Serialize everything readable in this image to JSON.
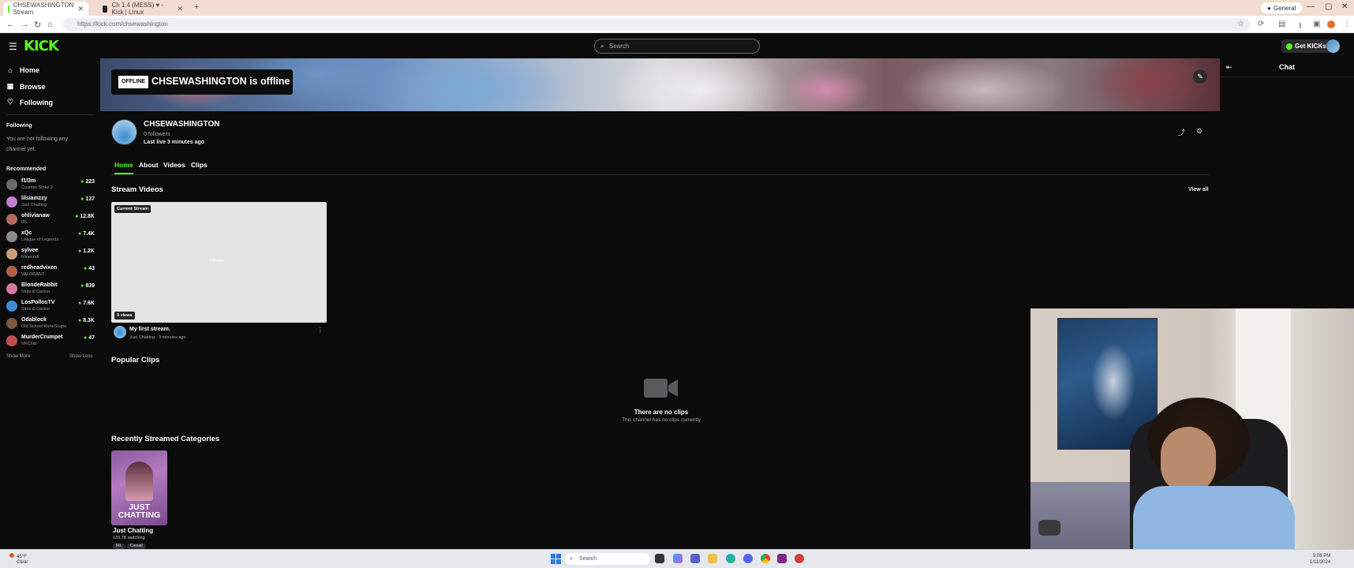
{
  "browser": {
    "tabs": [
      {
        "title": "CHSEWASHINGTON Stream",
        "color": "#53fc18",
        "active": true
      },
      {
        "title": "Ch 1.4 (MESS) ♥ - Kick | Linux",
        "color": "#222222",
        "active": false
      }
    ],
    "new_tab": "+",
    "profile_label": "General",
    "url": "https://kick.com/chsewashington"
  },
  "header": {
    "logo": "KICK",
    "search_placeholder": "Search",
    "get_kicks_label": "Get KICKs"
  },
  "sidebar": {
    "nav": [
      {
        "label": "Home",
        "icon": "home-icon"
      },
      {
        "label": "Browse",
        "icon": "browse-icon"
      },
      {
        "label": "Following",
        "icon": "heart-icon"
      }
    ],
    "following_title": "Following",
    "following_empty": "You are not following any channel yet.",
    "recommended_title": "Recommended",
    "recommended": [
      {
        "name": "f1l3m",
        "category": "Counter-Strike 2",
        "viewers": "223",
        "color": "#6b6b6b"
      },
      {
        "name": "lilsiamzzy",
        "category": "Just Chatting",
        "viewers": "137",
        "color": "#c67ad1"
      },
      {
        "name": "ohlivianaw",
        "category": "IRL",
        "viewers": "12.8K",
        "color": "#b56b5a"
      },
      {
        "name": "xQc",
        "category": "League of Legends",
        "viewers": "7.4K",
        "color": "#8a8a8a"
      },
      {
        "name": "sylvee",
        "category": "Minecraft",
        "viewers": "1.2K",
        "color": "#c9a07a"
      },
      {
        "name": "redheadvixen",
        "category": "VALORANT",
        "viewers": "43",
        "color": "#b0604a"
      },
      {
        "name": "BlondeRabbit",
        "category": "Slots & Casino",
        "viewers": "839",
        "color": "#d27aa0"
      },
      {
        "name": "LosPollosTV",
        "category": "Slots & Casino",
        "viewers": "7.6K",
        "color": "#3d8bd0"
      },
      {
        "name": "Odablock",
        "category": "Old School RuneScape",
        "viewers": "8.3K",
        "color": "#7a5a3a"
      },
      {
        "name": "MurderCrumpet",
        "category": "VRChat",
        "viewers": "47",
        "color": "#c05050"
      }
    ],
    "show_more": "Show More",
    "show_less": "Show Less"
  },
  "banner": {
    "offline_badge": "OFFLINE",
    "offline_text": "CHSEWASHINGTON is offline"
  },
  "channel": {
    "name": "CHSEWASHINGTON",
    "followers": "0 followers",
    "last_live": "Last live 3 minutes ago",
    "tabs": [
      "Home",
      "About",
      "Videos",
      "Clips"
    ],
    "active_tab": "Home"
  },
  "stream_videos": {
    "title": "Stream Videos",
    "view_all": "View all",
    "video": {
      "badge": "Current Stream",
      "thumb_text": "Private",
      "views": "0 views",
      "title": "My first stream.",
      "meta": "Just Chatting · 3 minutes ago"
    }
  },
  "popular_clips": {
    "title": "Popular Clips",
    "empty_title": "There are no clips",
    "empty_sub": "This channel has no clips currently"
  },
  "categories": {
    "title": "Recently Streamed Categories",
    "items": [
      {
        "name": "Just Chatting",
        "art_text": "JUST CHATTING",
        "watching": "133.7K watching",
        "tags": [
          "IRL",
          "Casual"
        ]
      }
    ]
  },
  "chat": {
    "title": "Chat"
  },
  "taskbar": {
    "weather_temp": "45°F",
    "weather_desc": "Clear",
    "search_placeholder": "Search",
    "time": "9:08 PM",
    "date": "1/11/2024"
  }
}
